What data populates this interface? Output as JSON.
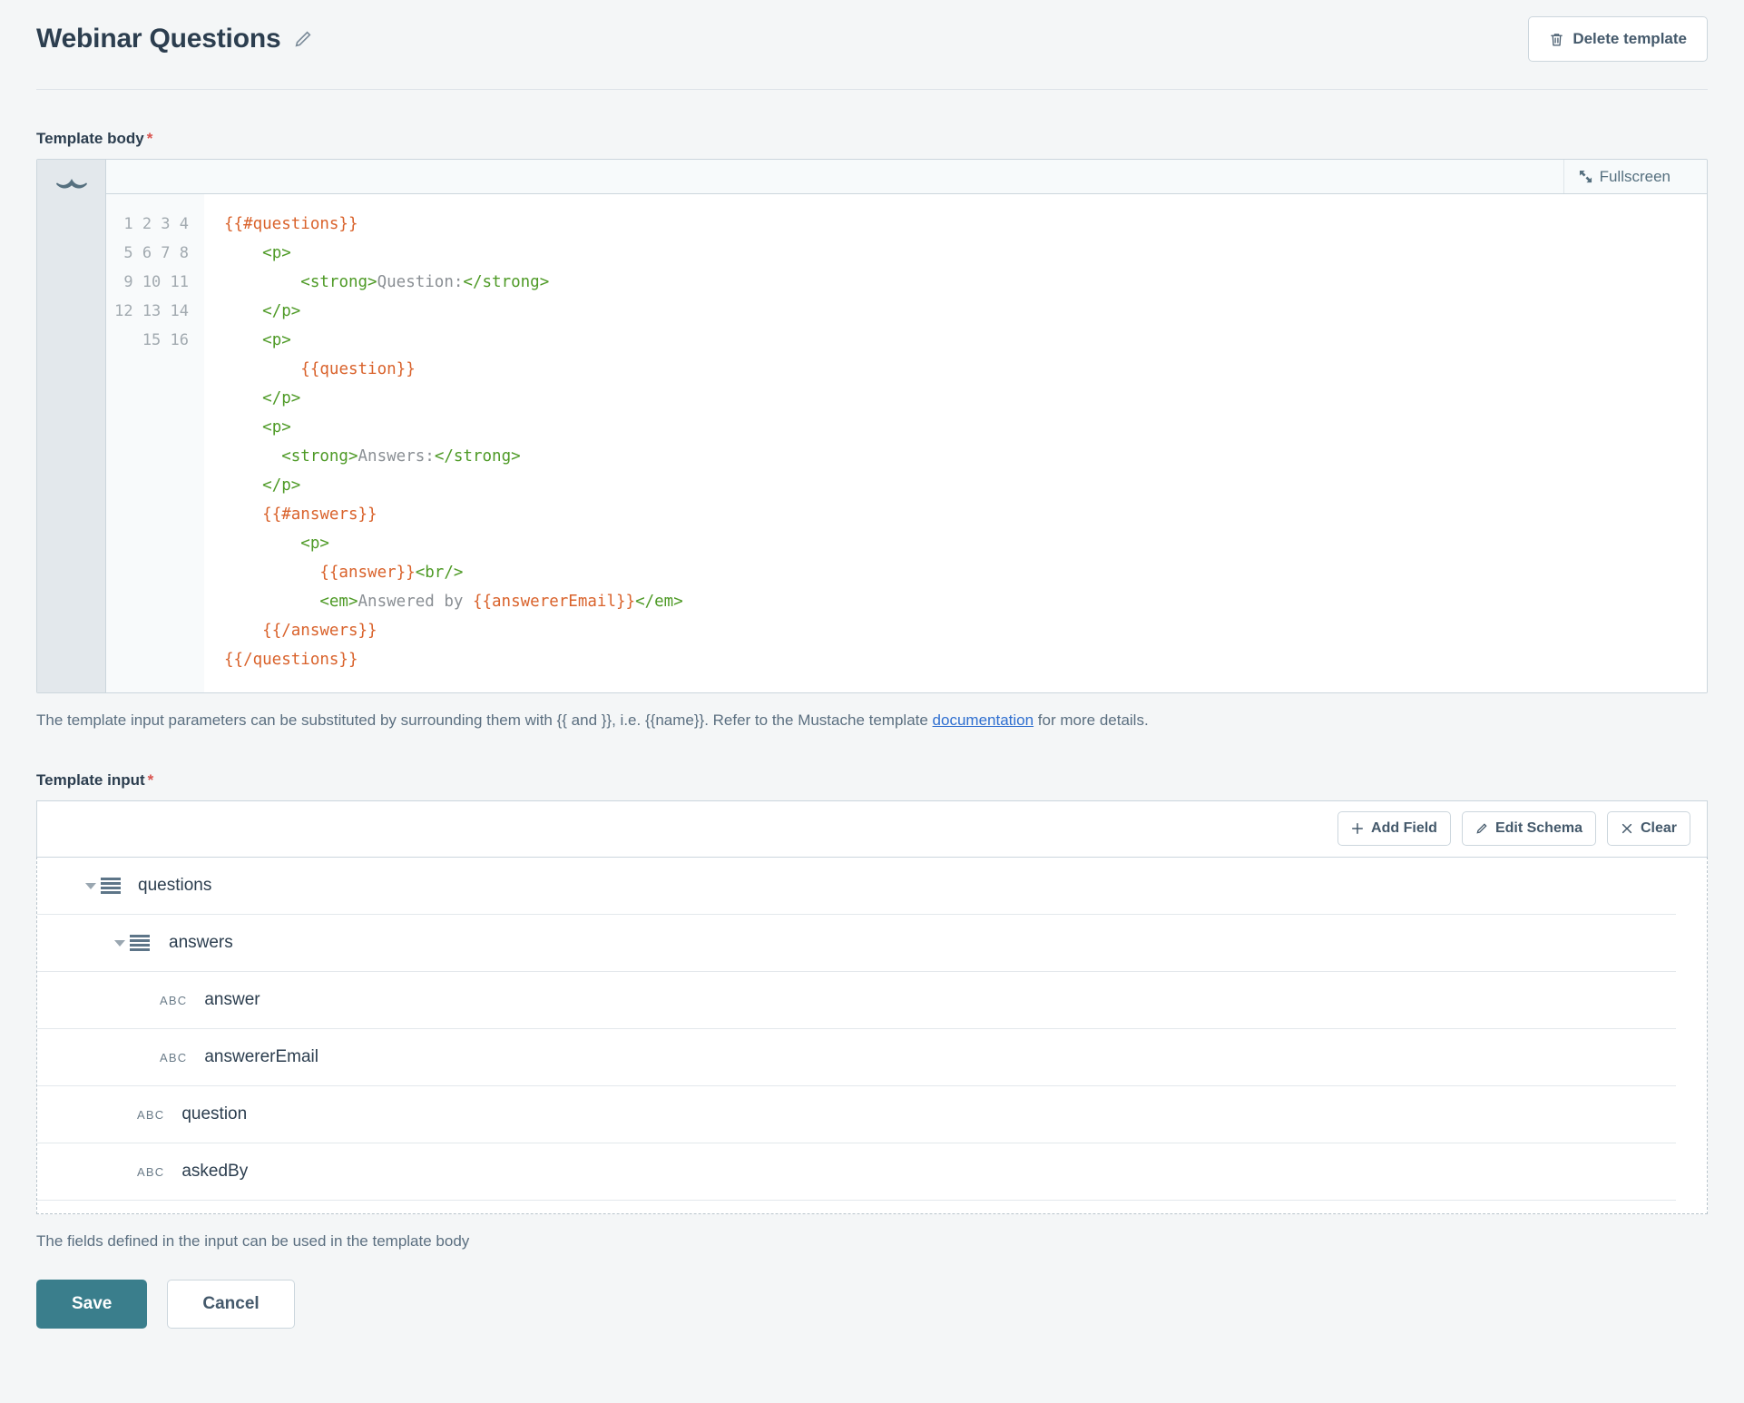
{
  "header": {
    "title": "Webinar Questions",
    "edit_icon": "pencil-icon",
    "delete_button": "Delete template",
    "delete_icon": "trash-icon"
  },
  "template_body": {
    "label": "Template body",
    "required_marker": "*",
    "rail_icon": "mustache-icon",
    "fullscreen_label": "Fullscreen",
    "fullscreen_icon": "expand-icon",
    "line_numbers": "1\n2\n3\n4\n5\n6\n7\n8\n9\n10\n11\n12\n13\n14\n15\n16",
    "lines": [
      {
        "n": 1,
        "indent": 0,
        "tokens": [
          {
            "t": "mustache",
            "v": "{{#questions}}"
          }
        ]
      },
      {
        "n": 2,
        "indent": 1,
        "tokens": [
          {
            "t": "tag",
            "v": "<p>"
          }
        ]
      },
      {
        "n": 3,
        "indent": 2,
        "tokens": [
          {
            "t": "tag",
            "v": "<strong>"
          },
          {
            "t": "text",
            "v": "Question:"
          },
          {
            "t": "tag",
            "v": "</strong>"
          }
        ]
      },
      {
        "n": 4,
        "indent": 1,
        "tokens": [
          {
            "t": "tag",
            "v": "</p>"
          }
        ]
      },
      {
        "n": 5,
        "indent": 1,
        "tokens": [
          {
            "t": "tag",
            "v": "<p>"
          }
        ]
      },
      {
        "n": 6,
        "indent": 2,
        "tokens": [
          {
            "t": "mustache",
            "v": "{{question}}"
          }
        ]
      },
      {
        "n": 7,
        "indent": 1,
        "tokens": [
          {
            "t": "tag",
            "v": "</p>"
          }
        ]
      },
      {
        "n": 8,
        "indent": 1,
        "tokens": [
          {
            "t": "tag",
            "v": "<p>"
          }
        ]
      },
      {
        "n": 9,
        "indent": 1.5,
        "tokens": [
          {
            "t": "tag",
            "v": "<strong>"
          },
          {
            "t": "text",
            "v": "Answers:"
          },
          {
            "t": "tag",
            "v": "</strong>"
          }
        ]
      },
      {
        "n": 10,
        "indent": 1,
        "tokens": [
          {
            "t": "tag",
            "v": "</p>"
          }
        ]
      },
      {
        "n": 11,
        "indent": 1,
        "tokens": [
          {
            "t": "mustache",
            "v": "{{#answers}}"
          }
        ]
      },
      {
        "n": 12,
        "indent": 2,
        "tokens": [
          {
            "t": "tag",
            "v": "<p>"
          }
        ]
      },
      {
        "n": 13,
        "indent": 2.5,
        "tokens": [
          {
            "t": "mustache",
            "v": "{{answer}}"
          },
          {
            "t": "tag",
            "v": "<br/>"
          }
        ]
      },
      {
        "n": 14,
        "indent": 2.5,
        "tokens": [
          {
            "t": "tag",
            "v": "<em>"
          },
          {
            "t": "text",
            "v": "Answered by "
          },
          {
            "t": "mustache",
            "v": "{{answererEmail}}"
          },
          {
            "t": "tag",
            "v": "</em>"
          }
        ]
      },
      {
        "n": 15,
        "indent": 1,
        "tokens": [
          {
            "t": "mustache",
            "v": "{{/answers}}"
          }
        ]
      },
      {
        "n": 16,
        "indent": 0,
        "tokens": [
          {
            "t": "mustache",
            "v": "{{/questions}}"
          }
        ]
      }
    ],
    "help_before": "The template input parameters can be substituted by surrounding them with {{ and }}, i.e. {{name}}. Refer to the Mustache template ",
    "help_link": "documentation",
    "help_after": " for more details."
  },
  "template_input": {
    "label": "Template input",
    "required_marker": "*",
    "toolbar": {
      "add_field": "Add Field",
      "add_field_icon": "plus-icon",
      "edit_schema": "Edit Schema",
      "edit_schema_icon": "pencil-icon",
      "clear": "Clear",
      "clear_icon": "close-icon"
    },
    "fields": [
      {
        "name": "questions",
        "type": "list",
        "type_icon": "list-icon",
        "level": 0,
        "expanded": true
      },
      {
        "name": "answers",
        "type": "list",
        "type_icon": "list-icon",
        "level": 1,
        "expanded": true
      },
      {
        "name": "answer",
        "type": "ABC",
        "type_icon": "abc-icon",
        "level": 2,
        "expanded": null
      },
      {
        "name": "answererEmail",
        "type": "ABC",
        "type_icon": "abc-icon",
        "level": 2,
        "expanded": null
      },
      {
        "name": "question",
        "type": "ABC",
        "type_icon": "abc-icon",
        "level": 1,
        "expanded": null
      },
      {
        "name": "askedBy",
        "type": "ABC",
        "type_icon": "abc-icon",
        "level": 1,
        "expanded": null
      }
    ],
    "help": "The fields defined in the input can be used in the template body"
  },
  "footer": {
    "save": "Save",
    "cancel": "Cancel"
  },
  "colors": {
    "page_bg": "#f4f6f7",
    "accent_save": "#3a7e8c",
    "required": "#d9534f",
    "link": "#2f6fd0",
    "code_mustache": "#d9622b",
    "code_tag": "#4e9a26",
    "code_text": "#8a8f94",
    "heading": "#2c3e4f"
  }
}
